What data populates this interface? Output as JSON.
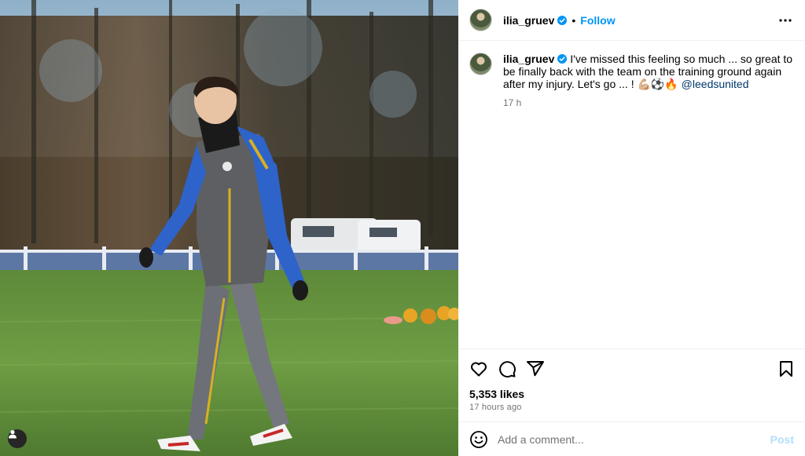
{
  "photo": {
    "alt": "",
    "tag_icon": "person-tag-icon"
  },
  "header": {
    "username": "ilia_gruev",
    "verified_icon": "verified-badge-icon",
    "separator": "•",
    "follow_label": "Follow",
    "more_icon": "more-options-icon"
  },
  "caption": {
    "username": "ilia_gruev",
    "text": "I've missed this feeling so much ... so great to be finally back with the team on the training ground again after my injury. Let's go ... ! 💪🏼⚽🔥",
    "mention": "@leedsunited",
    "time": "17 h"
  },
  "actions": {
    "like_icon": "heart-icon",
    "comment_icon": "comment-icon",
    "share_icon": "share-icon",
    "save_icon": "bookmark-icon",
    "likes": "5,353 likes",
    "posted": "17 hours ago"
  },
  "comment": {
    "emoji_icon": "emoji-icon",
    "placeholder": "Add a comment...",
    "post_label": "Post"
  },
  "colors": {
    "accent": "#0095f6",
    "mention": "#00376b",
    "secondary_text": "#737373",
    "post_disabled": "#b2dffc"
  }
}
